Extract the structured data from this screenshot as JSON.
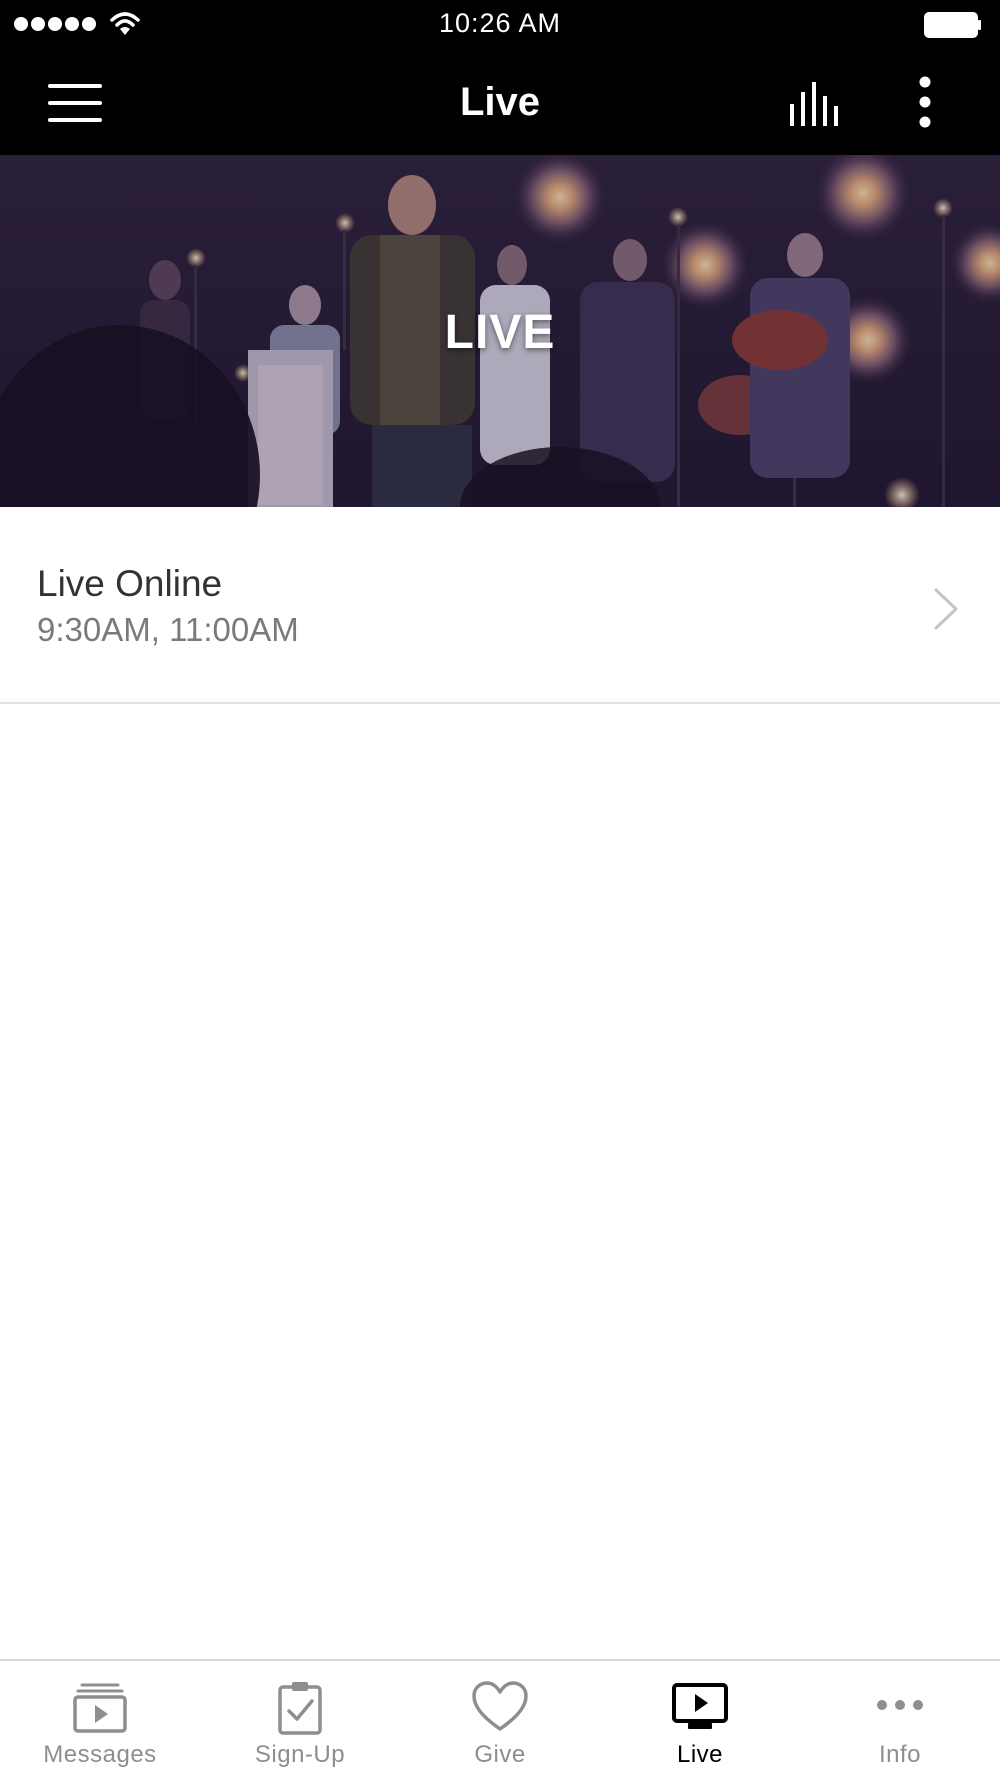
{
  "status_bar": {
    "time": "10:26 AM"
  },
  "nav": {
    "title": "Live",
    "menu_icon": "hamburger-menu-icon",
    "audio_icon": "audio-levels-icon",
    "more_icon": "more-vertical-icon"
  },
  "hero": {
    "label": "LIVE"
  },
  "list": {
    "items": [
      {
        "title": "Live Online",
        "subtitle": "9:30AM, 11:00AM"
      }
    ]
  },
  "tab_bar": {
    "tabs": [
      {
        "label": "Messages",
        "icon": "media-play-stack-icon",
        "active": false
      },
      {
        "label": "Sign-Up",
        "icon": "clipboard-check-icon",
        "active": false
      },
      {
        "label": "Give",
        "icon": "heart-icon",
        "active": false
      },
      {
        "label": "Live",
        "icon": "tv-play-icon",
        "active": true
      },
      {
        "label": "Info",
        "icon": "more-horizontal-icon",
        "active": false
      }
    ]
  },
  "colors": {
    "bar_background": "#000000",
    "active_tab": "#000000",
    "inactive_tab": "#8e8e8e",
    "divider": "#e3e3e3"
  }
}
